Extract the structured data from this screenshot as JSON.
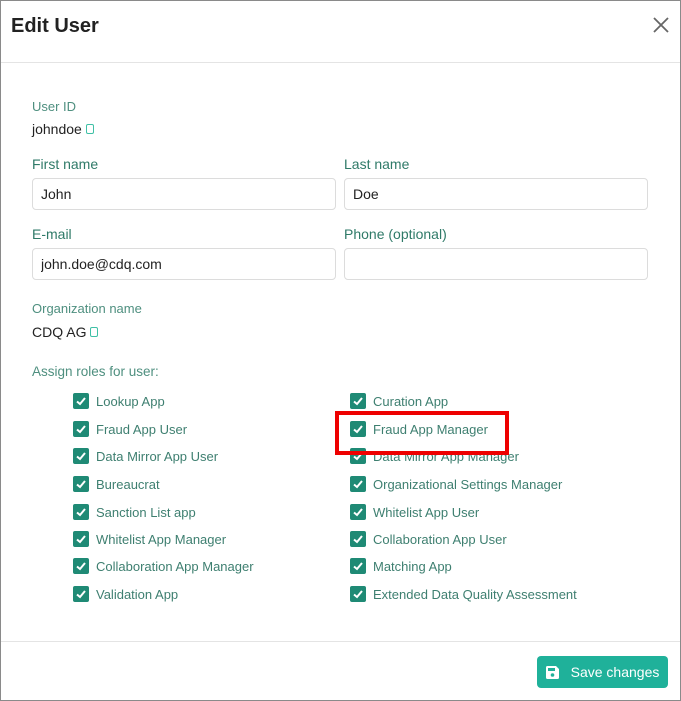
{
  "dialog": {
    "title": "Edit User",
    "close_icon": "close-icon"
  },
  "user_id": {
    "label": "User ID",
    "value": "johndoe"
  },
  "first_name": {
    "label": "First name",
    "value": "John"
  },
  "last_name": {
    "label": "Last name",
    "value": "Doe"
  },
  "email": {
    "label": "E-mail",
    "value": "john.doe@cdq.com"
  },
  "phone": {
    "label": "Phone (optional)",
    "value": ""
  },
  "organization": {
    "label": "Organization name",
    "value": "CDQ AG"
  },
  "roles": {
    "label": "Assign roles for user:",
    "left": [
      {
        "label": "Lookup App",
        "checked": true
      },
      {
        "label": "Fraud App User",
        "checked": true
      },
      {
        "label": "Data Mirror App User",
        "checked": true
      },
      {
        "label": "Bureaucrat",
        "checked": true
      },
      {
        "label": "Sanction List app",
        "checked": true
      },
      {
        "label": "Whitelist App Manager",
        "checked": true
      },
      {
        "label": "Collaboration App Manager",
        "checked": true
      },
      {
        "label": "Validation App",
        "checked": true
      }
    ],
    "right": [
      {
        "label": "Curation App",
        "checked": true
      },
      {
        "label": "Fraud App Manager",
        "checked": true
      },
      {
        "label": "Data Mirror App Manager",
        "checked": true
      },
      {
        "label": "Organizational Settings Manager",
        "checked": true
      },
      {
        "label": "Whitelist App User",
        "checked": true
      },
      {
        "label": "Collaboration App User",
        "checked": true
      },
      {
        "label": "Matching App",
        "checked": true
      },
      {
        "label": "Extended Data Quality Assessment",
        "checked": true
      }
    ]
  },
  "footer": {
    "save_label": "Save changes"
  },
  "colors": {
    "accent": "#1fb19a",
    "checkbox": "#1f8a75",
    "highlight": "#ee0000"
  }
}
